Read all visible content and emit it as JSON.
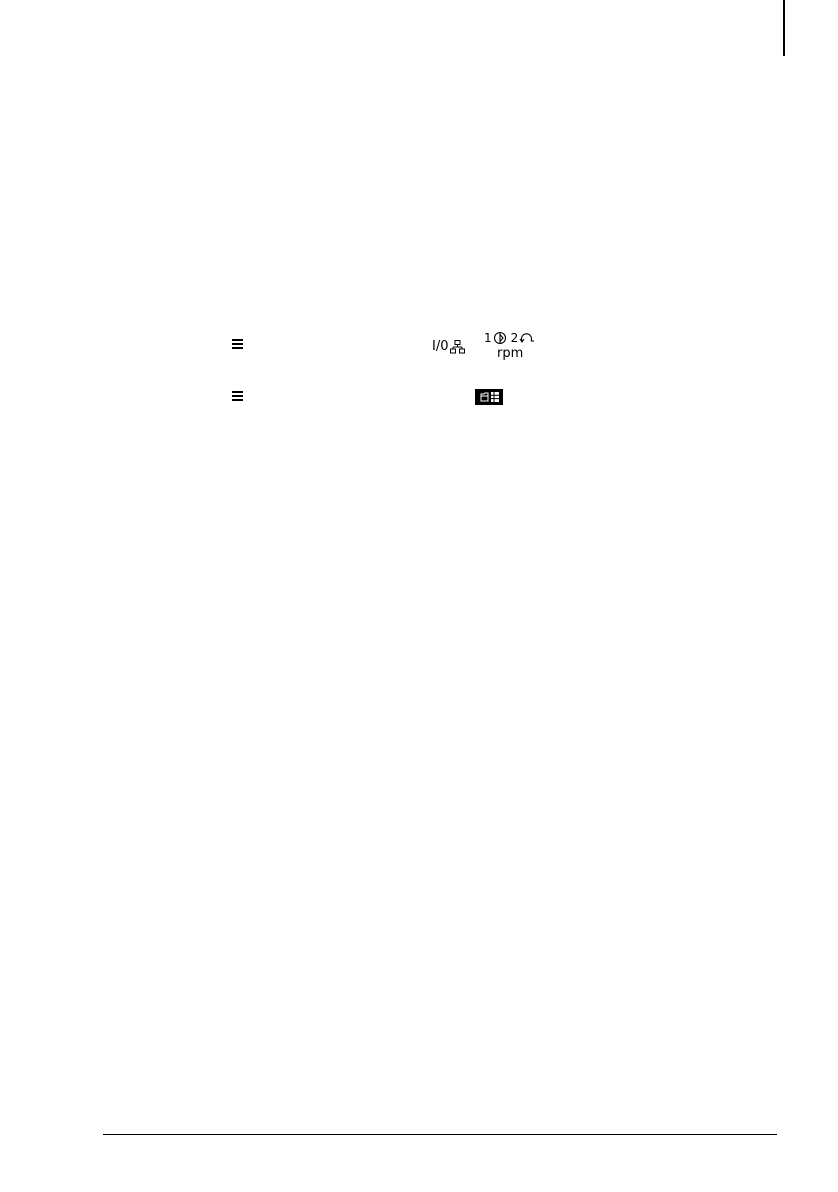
{
  "row1": {
    "menu_icon": "menu-icon",
    "io_label": "I/0",
    "network_icon": "network-icon",
    "direction": {
      "forward_number": "1",
      "forward_icon": "forward-rotation-icon",
      "reverse_number": "2",
      "reverse_icon": "reverse-rotation-icon",
      "unit": "rpm"
    }
  },
  "row2": {
    "menu_icon": "menu-icon",
    "params_icon": "parameters-icon"
  },
  "colors": {
    "ink": "#000000",
    "paper": "#ffffff"
  }
}
